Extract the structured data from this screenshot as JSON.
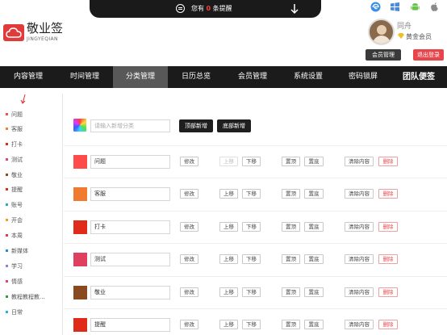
{
  "notification": {
    "prefix": "您有",
    "count": "0",
    "suffix": "条提醒"
  },
  "brand": {
    "name": "敬业签",
    "sub": "JINGYEQIAN"
  },
  "user": {
    "name": "同舟",
    "level": "黄金会员"
  },
  "header_buttons": {
    "member": "会员管理",
    "logout": "退出登录"
  },
  "nav": [
    {
      "label": "内容管理"
    },
    {
      "label": "时间管理"
    },
    {
      "label": "分类管理",
      "active": true
    },
    {
      "label": "日历总览"
    },
    {
      "label": "会员管理"
    },
    {
      "label": "系统设置"
    },
    {
      "label": "密码锁屏"
    },
    {
      "label": "团队便签",
      "bold": true
    }
  ],
  "sidebar": [
    {
      "label": "问题",
      "color": "#ff4a4a"
    },
    {
      "label": "客服",
      "color": "#f08030"
    },
    {
      "label": "打卡",
      "color": "#e02a1a"
    },
    {
      "label": "测试",
      "color": "#e04a6a"
    },
    {
      "label": "敬业",
      "color": "#8a4a20"
    },
    {
      "label": "提醒",
      "color": "#e02a1a"
    },
    {
      "label": "账号",
      "color": "#2ab0b0"
    },
    {
      "label": "开会",
      "color": "#f0a020"
    },
    {
      "label": "本周",
      "color": "#e04040"
    },
    {
      "label": "新媒体",
      "color": "#2a8ad8"
    },
    {
      "label": "学习",
      "color": "#9a7ad8"
    },
    {
      "label": "情感",
      "color": "#e04a6a"
    },
    {
      "label": "教程教程教...",
      "color": "#3a9a3a"
    },
    {
      "label": "日常",
      "color": "#2ab0e0"
    }
  ],
  "new_category": {
    "placeholder": "请输入新增分类",
    "top_add": "顶部新增",
    "bottom_add": "底部新增"
  },
  "buttons": {
    "edit": "修改",
    "up": "上移",
    "down": "下移",
    "top": "置顶",
    "bottom": "置底",
    "clear": "清除内容",
    "remove": "删除"
  },
  "categories": [
    {
      "name": "问题",
      "color": "#ff4a4a",
      "up_disabled": true
    },
    {
      "name": "客服",
      "color": "#f07a30"
    },
    {
      "name": "打卡",
      "color": "#e02a1a"
    },
    {
      "name": "测试",
      "color": "#e04060"
    },
    {
      "name": "敬业",
      "color": "#8a4a20"
    },
    {
      "name": "提醒",
      "color": "#e02a1a"
    }
  ]
}
